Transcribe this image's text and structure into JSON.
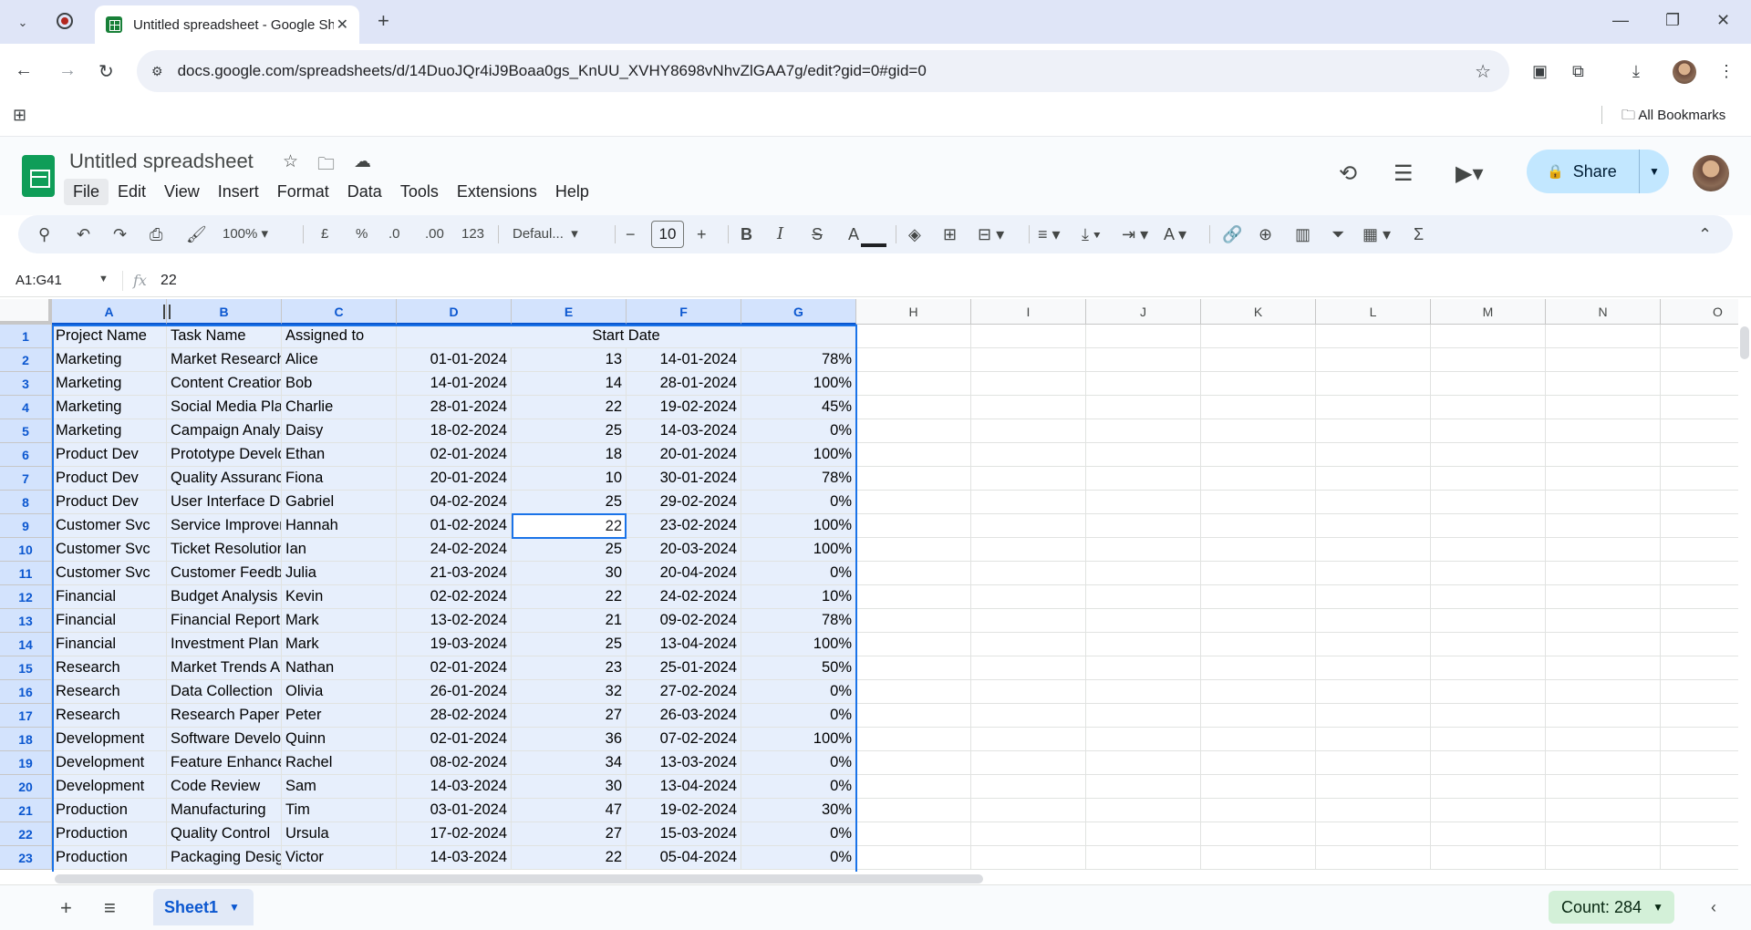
{
  "browser": {
    "tab_title": "Untitled spreadsheet - Google Sheets",
    "url": "docs.google.com/spreadsheets/d/14DuoJQr4iJ9Boaa0gs_KnUU_XVHY8698vNhvZlGAA7g/edit?gid=0#gid=0",
    "bookmarks_label": "All Bookmarks"
  },
  "app": {
    "doc_title": "Untitled spreadsheet",
    "menus": [
      "File",
      "Edit",
      "View",
      "Insert",
      "Format",
      "Data",
      "Tools",
      "Extensions",
      "Help"
    ],
    "share_label": "Share"
  },
  "toolbar": {
    "zoom": "100%",
    "currency": "£",
    "percent": "%",
    "dec_decrease": ".0",
    "dec_increase": ".00",
    "number_format": "123",
    "font": "Defaul...",
    "font_size": "10"
  },
  "formula_bar": {
    "name_box": "A1:G41",
    "fx": "fx",
    "value": "22"
  },
  "grid": {
    "columns": [
      "A",
      "B",
      "C",
      "D",
      "E",
      "F",
      "G",
      "H",
      "I",
      "J",
      "K",
      "L",
      "M",
      "N",
      "O"
    ],
    "row_numbers": [
      "1",
      "2",
      "3",
      "4",
      "5",
      "6",
      "7",
      "8",
      "9",
      "10",
      "11",
      "12",
      "13",
      "14",
      "15",
      "16",
      "17",
      "18",
      "19",
      "20",
      "21",
      "22",
      "23"
    ],
    "header_row": [
      "Project Name",
      "Task Name",
      "Assigned to",
      "Start Date"
    ],
    "rows": [
      [
        "Marketing",
        "Market Research",
        "Alice",
        "01-01-2024",
        "13",
        "14-01-2024",
        "78%"
      ],
      [
        "Marketing",
        "Content Creation",
        "Bob",
        "14-01-2024",
        "14",
        "28-01-2024",
        "100%"
      ],
      [
        "Marketing",
        "Social Media Plan",
        "Charlie",
        "28-01-2024",
        "22",
        "19-02-2024",
        "45%"
      ],
      [
        "Marketing",
        "Campaign Analysis",
        "Daisy",
        "18-02-2024",
        "25",
        "14-03-2024",
        "0%"
      ],
      [
        "Product Dev",
        "Prototype Development",
        "Ethan",
        "02-01-2024",
        "18",
        "20-01-2024",
        "100%"
      ],
      [
        "Product Dev",
        "Quality Assurance",
        "Fiona",
        "20-01-2024",
        "10",
        "30-01-2024",
        "78%"
      ],
      [
        "Product Dev",
        "User Interface Design",
        "Gabriel",
        "04-02-2024",
        "25",
        "29-02-2024",
        "0%"
      ],
      [
        "Customer Svc",
        "Service Improvement",
        "Hannah",
        "01-02-2024",
        "22",
        "23-02-2024",
        "100%"
      ],
      [
        "Customer Svc",
        "Ticket Resolution",
        "Ian",
        "24-02-2024",
        "25",
        "20-03-2024",
        "100%"
      ],
      [
        "Customer Svc",
        "Customer Feedback",
        "Julia",
        "21-03-2024",
        "30",
        "20-04-2024",
        "0%"
      ],
      [
        "Financial",
        "Budget Analysis",
        "Kevin",
        "02-02-2024",
        "22",
        "24-02-2024",
        "10%"
      ],
      [
        "Financial",
        "Financial Report",
        "Mark",
        "13-02-2024",
        "21",
        "09-02-2024",
        "78%"
      ],
      [
        "Financial",
        "Investment Plan",
        "Mark",
        "19-03-2024",
        "25",
        "13-04-2024",
        "100%"
      ],
      [
        "Research",
        "Market Trends Analysis",
        "Nathan",
        "02-01-2024",
        "23",
        "25-01-2024",
        "50%"
      ],
      [
        "Research",
        "Data Collection",
        "Olivia",
        "26-01-2024",
        "32",
        "27-02-2024",
        "0%"
      ],
      [
        "Research",
        "Research Paper",
        "Peter",
        "28-02-2024",
        "27",
        "26-03-2024",
        "0%"
      ],
      [
        "Development",
        "Software Development",
        "Quinn",
        "02-01-2024",
        "36",
        "07-02-2024",
        "100%"
      ],
      [
        "Development",
        "Feature Enhancement",
        "Rachel",
        "08-02-2024",
        "34",
        "13-03-2024",
        "0%"
      ],
      [
        "Development",
        "Code Review",
        "Sam",
        "14-03-2024",
        "30",
        "13-04-2024",
        "0%"
      ],
      [
        "Production",
        "Manufacturing",
        "Tim",
        "03-01-2024",
        "47",
        "19-02-2024",
        "30%"
      ],
      [
        "Production",
        "Quality Control",
        "Ursula",
        "17-02-2024",
        "27",
        "15-03-2024",
        "0%"
      ],
      [
        "Production",
        "Packaging Design",
        "Victor",
        "14-03-2024",
        "22",
        "05-04-2024",
        "0%"
      ]
    ]
  },
  "bottom": {
    "sheet_name": "Sheet1",
    "count_label": "Count: 284"
  },
  "colors": {
    "selection": "#e7effc",
    "accent": "#1a73e8",
    "share_bg": "#c2e7ff",
    "count_bg": "#d3f0d8"
  }
}
